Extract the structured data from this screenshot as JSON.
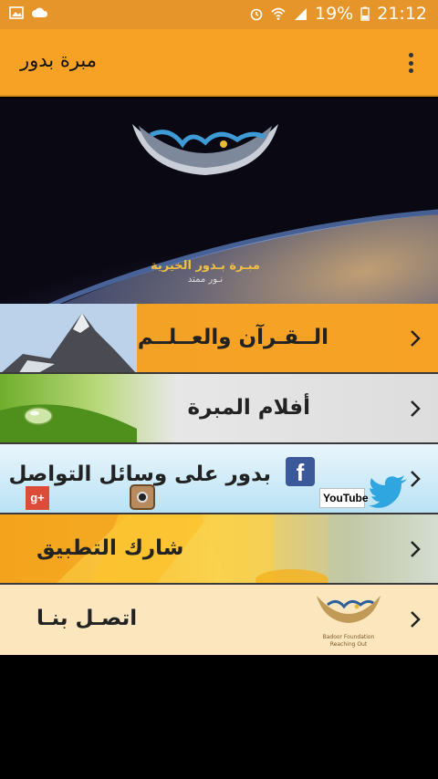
{
  "status_bar": {
    "battery_percent": "19%",
    "time": "21:12",
    "left_icons": [
      "image-icon",
      "cloud-icon"
    ],
    "right_icons": [
      "alarm-icon",
      "wifi-icon",
      "signal-icon",
      "battery-icon"
    ]
  },
  "app_bar": {
    "title": "مبرة بدور",
    "menu_icon": "kebab-menu-icon"
  },
  "banner": {
    "logo_text": "مبـرة بـدور الخيرية",
    "logo_subtext": "نـور ممتد"
  },
  "menu_items": [
    {
      "label": "الــقـرآن والعــلــم",
      "icon": "mountain-image"
    },
    {
      "label": "أفلام المبرة",
      "icon": "water-drop-image"
    },
    {
      "label": "بدور على وسائل التواصل",
      "icons": [
        "facebook-icon",
        "twitter-icon",
        "youtube-icon",
        "instagram-icon",
        "google-plus-icon"
      ],
      "badges": {
        "youtube": "YouTube",
        "gplus": "g+"
      }
    },
    {
      "label": "شارك التطبيق",
      "icon": "sunflower-image"
    },
    {
      "label": "اتصـل بنـا",
      "icon": "badoor-logo-icon",
      "logo_lines": [
        "Badoor Foundation",
        "Reaching Out"
      ]
    }
  ],
  "colors": {
    "app_bar": "#f7a224",
    "status_bar": "#e6952a"
  }
}
